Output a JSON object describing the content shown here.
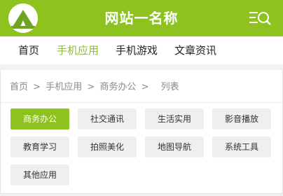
{
  "header": {
    "title": "网站一名称",
    "search_icon": "menu-search-icon",
    "logo_icon": "tent-logo-icon"
  },
  "colors": {
    "accent": "#8dc21f",
    "tag_bg": "#efefef"
  },
  "nav": {
    "items": [
      {
        "label": "首页",
        "active": false
      },
      {
        "label": "手机应用",
        "active": true
      },
      {
        "label": "手机游戏",
        "active": false
      },
      {
        "label": "文章资讯",
        "active": false
      }
    ]
  },
  "breadcrumb": {
    "items": [
      "首页",
      "手机应用",
      "商务办公"
    ],
    "separator": ">",
    "current": "列表"
  },
  "categories": [
    {
      "label": "商务办公",
      "active": true
    },
    {
      "label": "社交通讯",
      "active": false
    },
    {
      "label": "生活实用",
      "active": false
    },
    {
      "label": "影音播放",
      "active": false
    },
    {
      "label": "教育学习",
      "active": false
    },
    {
      "label": "拍照美化",
      "active": false
    },
    {
      "label": "地图导航",
      "active": false
    },
    {
      "label": "系统工具",
      "active": false
    },
    {
      "label": "其他应用",
      "active": false
    }
  ]
}
